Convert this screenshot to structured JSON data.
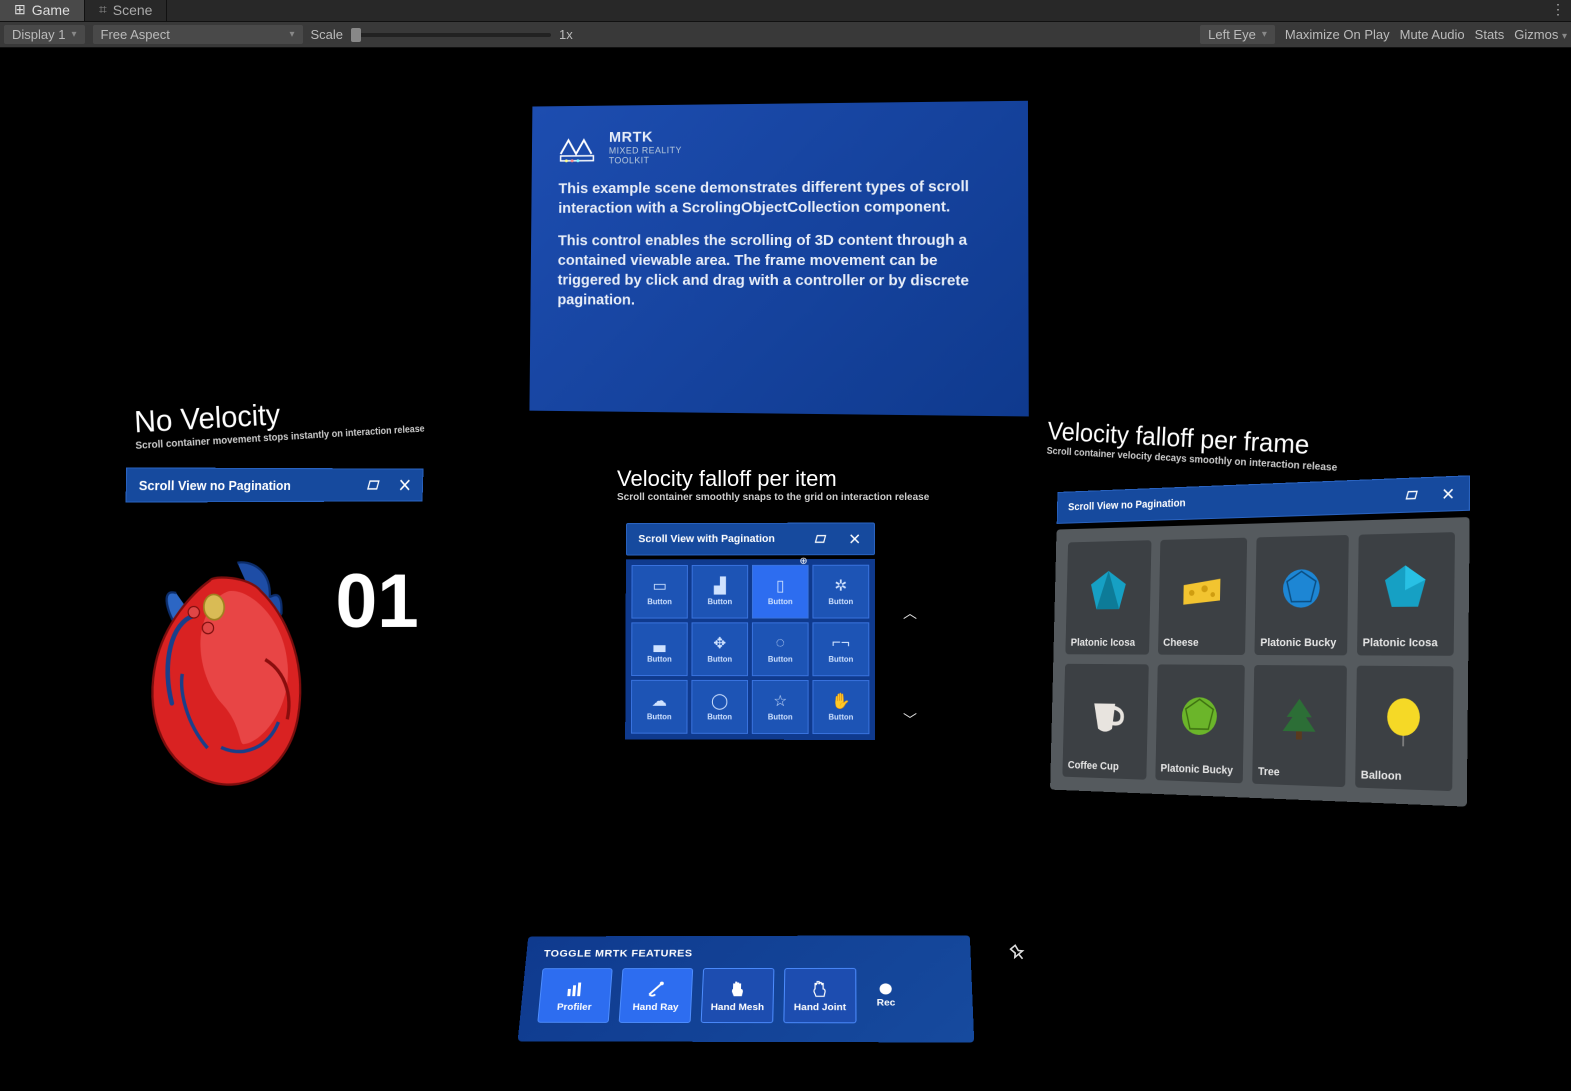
{
  "tabs": {
    "game": "Game",
    "scene": "Scene"
  },
  "toolbar": {
    "display": "Display 1",
    "aspect": "Free Aspect",
    "scale_label": "Scale",
    "scale_value": "1x",
    "eye": "Left Eye",
    "maximize": "Maximize On Play",
    "mute": "Mute Audio",
    "stats": "Stats",
    "gizmos": "Gizmos"
  },
  "info": {
    "logo_title": "MRTK",
    "logo_sub": "MIXED REALITY\nTOOLKIT",
    "p1": "This example scene demonstrates different types of scroll interaction with a ScrolingObjectCollection component.",
    "p2": "This control enables the scrolling of 3D content through a contained viewable area. The frame movement can be triggered by click and drag with a controller or by discrete pagination."
  },
  "left": {
    "title": "No Velocity",
    "sub": "Scroll container movement stops instantly on interaction release",
    "bar_title": "Scroll View no Pagination",
    "number": "01"
  },
  "center": {
    "title": "Velocity falloff per item",
    "sub": "Scroll container smoothly snaps to the grid on interaction release",
    "bar_title": "Scroll View with Pagination",
    "button_label": "Button"
  },
  "right": {
    "title": "Velocity falloff per frame",
    "sub": "Scroll container velocity decays smoothly on interaction release",
    "bar_title": "Scroll View no Pagination",
    "cards": [
      "Platonic Icosa",
      "Cheese",
      "Platonic Bucky",
      "Platonic Icosa",
      "Coffee Cup",
      "Platonic Bucky",
      "Tree",
      "Balloon"
    ]
  },
  "toggles": {
    "title": "TOGGLE MRTK FEATURES",
    "buttons": [
      "Profiler",
      "Hand Ray",
      "Hand Mesh",
      "Hand Joint"
    ],
    "rec": "Rec"
  },
  "icons": {
    "follow": "follow-icon",
    "close": "close-icon",
    "pin": "pin-icon"
  }
}
